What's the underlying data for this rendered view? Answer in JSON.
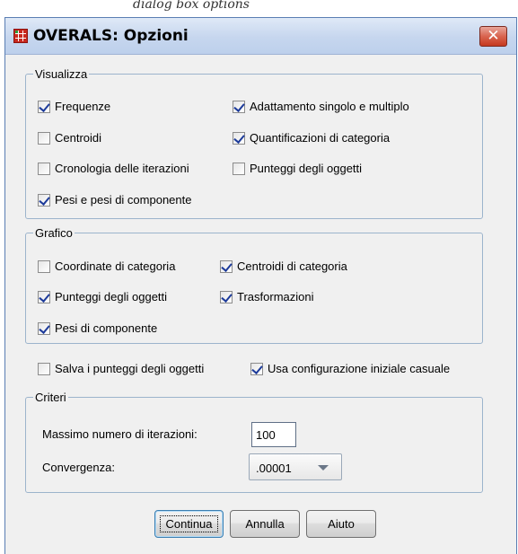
{
  "caption": {
    "text": "dialog box options"
  },
  "window": {
    "title": "OVERALS: Opzioni",
    "close_label": "✕"
  },
  "visualizza": {
    "legend": "Visualizza",
    "options": [
      {
        "label": "Frequenze",
        "checked": true
      },
      {
        "label": "Adattamento singolo e multiplo",
        "checked": true
      },
      {
        "label": "Centroidi",
        "checked": false
      },
      {
        "label": "Quantificazioni di categoria",
        "checked": true
      },
      {
        "label": "Cronologia delle iterazioni",
        "checked": false
      },
      {
        "label": "Punteggi degli oggetti",
        "checked": false
      },
      {
        "label": "Pesi e pesi di componente",
        "checked": true
      }
    ]
  },
  "grafico": {
    "legend": "Grafico",
    "options": [
      {
        "label": "Coordinate di categoria",
        "checked": false
      },
      {
        "label": "Centroidi di categoria",
        "checked": true
      },
      {
        "label": "Punteggi degli oggetti",
        "checked": true
      },
      {
        "label": "Trasformazioni",
        "checked": true
      },
      {
        "label": "Pesi di componente",
        "checked": true
      }
    ]
  },
  "extra": {
    "options": [
      {
        "label": "Salva i punteggi degli oggetti",
        "checked": false
      },
      {
        "label": "Usa configurazione iniziale casuale",
        "checked": true
      }
    ]
  },
  "criteri": {
    "legend": "Criteri",
    "max_iter_label": "Massimo numero di iterazioni:",
    "max_iter_value": "100",
    "convergence_label": "Convergenza:",
    "convergence_value": ".00001"
  },
  "buttons": {
    "continue": "Continua",
    "cancel": "Annulla",
    "help": "Aiuto"
  }
}
